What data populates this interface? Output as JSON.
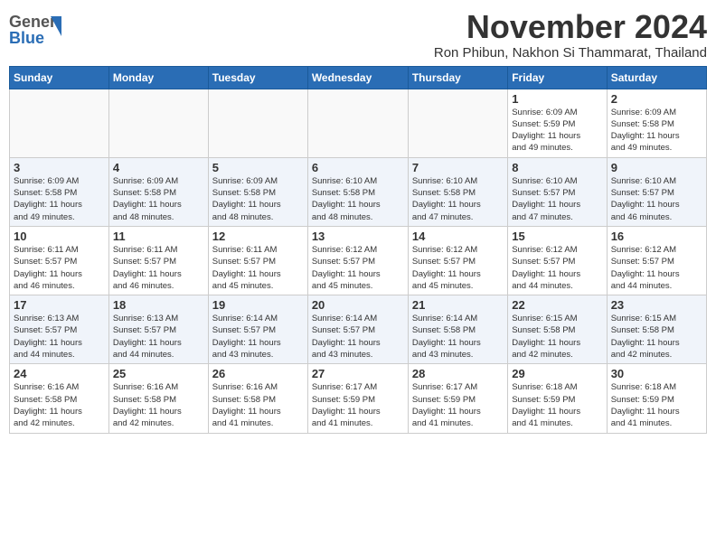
{
  "header": {
    "logo_line1": "General",
    "logo_line2": "Blue",
    "month_title": "November 2024",
    "subtitle": "Ron Phibun, Nakhon Si Thammarat, Thailand"
  },
  "days_of_week": [
    "Sunday",
    "Monday",
    "Tuesday",
    "Wednesday",
    "Thursday",
    "Friday",
    "Saturday"
  ],
  "weeks": [
    {
      "days": [
        {
          "date": "",
          "info": ""
        },
        {
          "date": "",
          "info": ""
        },
        {
          "date": "",
          "info": ""
        },
        {
          "date": "",
          "info": ""
        },
        {
          "date": "",
          "info": ""
        },
        {
          "date": "1",
          "info": "Sunrise: 6:09 AM\nSunset: 5:59 PM\nDaylight: 11 hours\nand 49 minutes."
        },
        {
          "date": "2",
          "info": "Sunrise: 6:09 AM\nSunset: 5:58 PM\nDaylight: 11 hours\nand 49 minutes."
        }
      ]
    },
    {
      "days": [
        {
          "date": "3",
          "info": "Sunrise: 6:09 AM\nSunset: 5:58 PM\nDaylight: 11 hours\nand 49 minutes."
        },
        {
          "date": "4",
          "info": "Sunrise: 6:09 AM\nSunset: 5:58 PM\nDaylight: 11 hours\nand 48 minutes."
        },
        {
          "date": "5",
          "info": "Sunrise: 6:09 AM\nSunset: 5:58 PM\nDaylight: 11 hours\nand 48 minutes."
        },
        {
          "date": "6",
          "info": "Sunrise: 6:10 AM\nSunset: 5:58 PM\nDaylight: 11 hours\nand 48 minutes."
        },
        {
          "date": "7",
          "info": "Sunrise: 6:10 AM\nSunset: 5:58 PM\nDaylight: 11 hours\nand 47 minutes."
        },
        {
          "date": "8",
          "info": "Sunrise: 6:10 AM\nSunset: 5:57 PM\nDaylight: 11 hours\nand 47 minutes."
        },
        {
          "date": "9",
          "info": "Sunrise: 6:10 AM\nSunset: 5:57 PM\nDaylight: 11 hours\nand 46 minutes."
        }
      ]
    },
    {
      "days": [
        {
          "date": "10",
          "info": "Sunrise: 6:11 AM\nSunset: 5:57 PM\nDaylight: 11 hours\nand 46 minutes."
        },
        {
          "date": "11",
          "info": "Sunrise: 6:11 AM\nSunset: 5:57 PM\nDaylight: 11 hours\nand 46 minutes."
        },
        {
          "date": "12",
          "info": "Sunrise: 6:11 AM\nSunset: 5:57 PM\nDaylight: 11 hours\nand 45 minutes."
        },
        {
          "date": "13",
          "info": "Sunrise: 6:12 AM\nSunset: 5:57 PM\nDaylight: 11 hours\nand 45 minutes."
        },
        {
          "date": "14",
          "info": "Sunrise: 6:12 AM\nSunset: 5:57 PM\nDaylight: 11 hours\nand 45 minutes."
        },
        {
          "date": "15",
          "info": "Sunrise: 6:12 AM\nSunset: 5:57 PM\nDaylight: 11 hours\nand 44 minutes."
        },
        {
          "date": "16",
          "info": "Sunrise: 6:12 AM\nSunset: 5:57 PM\nDaylight: 11 hours\nand 44 minutes."
        }
      ]
    },
    {
      "days": [
        {
          "date": "17",
          "info": "Sunrise: 6:13 AM\nSunset: 5:57 PM\nDaylight: 11 hours\nand 44 minutes."
        },
        {
          "date": "18",
          "info": "Sunrise: 6:13 AM\nSunset: 5:57 PM\nDaylight: 11 hours\nand 44 minutes."
        },
        {
          "date": "19",
          "info": "Sunrise: 6:14 AM\nSunset: 5:57 PM\nDaylight: 11 hours\nand 43 minutes."
        },
        {
          "date": "20",
          "info": "Sunrise: 6:14 AM\nSunset: 5:57 PM\nDaylight: 11 hours\nand 43 minutes."
        },
        {
          "date": "21",
          "info": "Sunrise: 6:14 AM\nSunset: 5:58 PM\nDaylight: 11 hours\nand 43 minutes."
        },
        {
          "date": "22",
          "info": "Sunrise: 6:15 AM\nSunset: 5:58 PM\nDaylight: 11 hours\nand 42 minutes."
        },
        {
          "date": "23",
          "info": "Sunrise: 6:15 AM\nSunset: 5:58 PM\nDaylight: 11 hours\nand 42 minutes."
        }
      ]
    },
    {
      "days": [
        {
          "date": "24",
          "info": "Sunrise: 6:16 AM\nSunset: 5:58 PM\nDaylight: 11 hours\nand 42 minutes."
        },
        {
          "date": "25",
          "info": "Sunrise: 6:16 AM\nSunset: 5:58 PM\nDaylight: 11 hours\nand 42 minutes."
        },
        {
          "date": "26",
          "info": "Sunrise: 6:16 AM\nSunset: 5:58 PM\nDaylight: 11 hours\nand 41 minutes."
        },
        {
          "date": "27",
          "info": "Sunrise: 6:17 AM\nSunset: 5:59 PM\nDaylight: 11 hours\nand 41 minutes."
        },
        {
          "date": "28",
          "info": "Sunrise: 6:17 AM\nSunset: 5:59 PM\nDaylight: 11 hours\nand 41 minutes."
        },
        {
          "date": "29",
          "info": "Sunrise: 6:18 AM\nSunset: 5:59 PM\nDaylight: 11 hours\nand 41 minutes."
        },
        {
          "date": "30",
          "info": "Sunrise: 6:18 AM\nSunset: 5:59 PM\nDaylight: 11 hours\nand 41 minutes."
        }
      ]
    }
  ]
}
